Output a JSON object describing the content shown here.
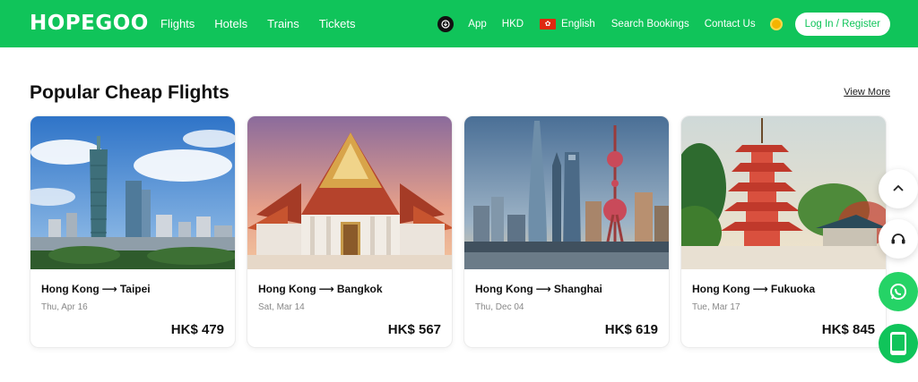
{
  "header": {
    "logo_text_1": "HOPE",
    "logo_text_2": "GOO",
    "nav": [
      "Flights",
      "Hotels",
      "Trains",
      "Tickets"
    ],
    "app_label": "App",
    "currency": "HKD",
    "language": "English",
    "search_bookings": "Search Bookings",
    "contact_us": "Contact Us",
    "login_label": "Log In / Register"
  },
  "section": {
    "title": "Popular Cheap Flights",
    "view_more": "View More"
  },
  "cards": [
    {
      "from": "Hong Kong",
      "to": "Taipei",
      "date": "Thu, Apr 16",
      "price": "HK$ 479",
      "image": "taipei-skyline"
    },
    {
      "from": "Hong Kong",
      "to": "Bangkok",
      "date": "Sat, Mar 14",
      "price": "HK$ 567",
      "image": "bangkok-temple"
    },
    {
      "from": "Hong Kong",
      "to": "Shanghai",
      "date": "Thu, Dec 04",
      "price": "HK$ 619",
      "image": "shanghai-skyline"
    },
    {
      "from": "Hong Kong",
      "to": "Fukuoka",
      "date": "Tue, Mar 17",
      "price": "HK$ 845",
      "image": "fukuoka-pagoda"
    }
  ],
  "colors": {
    "brand": "#10c45a",
    "whatsapp": "#25d366"
  },
  "floating": {
    "icons": [
      "chevron-up-icon",
      "headset-icon",
      "whatsapp-icon",
      "app-phone-icon"
    ],
    "app_badge": "GO"
  }
}
